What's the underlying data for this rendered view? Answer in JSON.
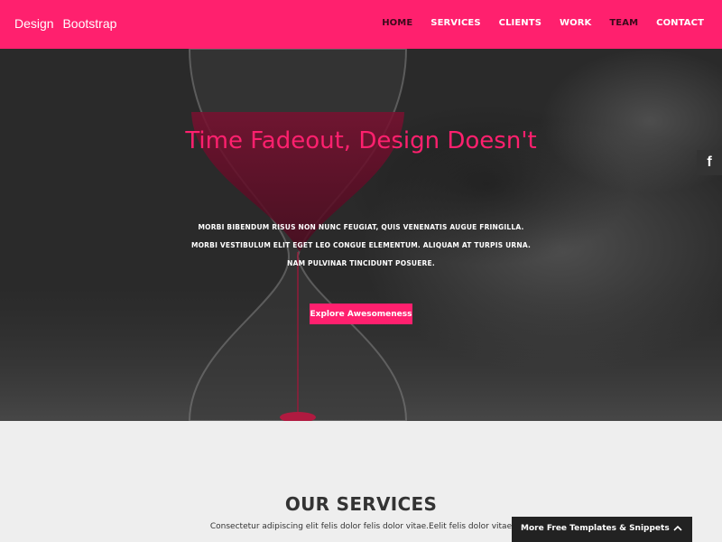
{
  "navbar": {
    "brand": "Design Bootstrap",
    "links": [
      {
        "label": "HOME",
        "active": true
      },
      {
        "label": "SERVICES",
        "active": false
      },
      {
        "label": "CLIENTS",
        "active": false
      },
      {
        "label": "WORK",
        "active": false
      },
      {
        "label": "TEAM",
        "active": true
      },
      {
        "label": "CONTACT",
        "active": false
      }
    ]
  },
  "hero": {
    "title": "Time Fadeout, Design Doesn't",
    "text": "Morbi bibendum risus non nunc feugiat, quis venenatis augue fringilla. Morbi vestibulum elit eget leo congue elementum. Aliquam at turpis urna. Nam pulvinar tincidunt posuere.",
    "button": "Explore Awesomeness"
  },
  "social": {
    "facebook_glyph": "f",
    "icon": "facebook-icon"
  },
  "services": {
    "title": "OUR SERVICES",
    "text": "Consectetur adipiscing elit felis dolor felis dolor vitae.Eelit felis dolor vitae"
  },
  "promo": {
    "label": "More Free Templates & Snippets",
    "icon": "chevron-up-icon"
  },
  "colors": {
    "brand": "#ff206e",
    "dark": "#222222",
    "section_bg": "#eeeeee"
  }
}
